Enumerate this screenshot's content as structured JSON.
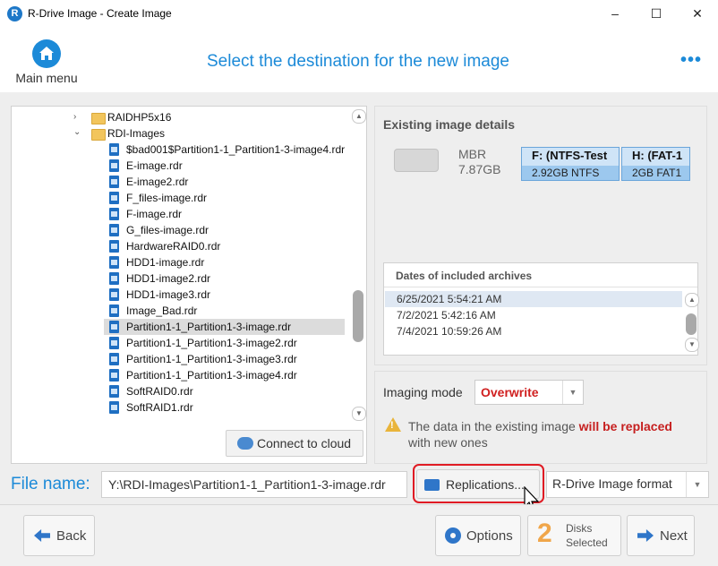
{
  "window": {
    "title": "R-Drive Image - Create Image",
    "logo_letter": "R",
    "minimize": "–",
    "maximize": "☐",
    "close": "✕"
  },
  "header": {
    "main_menu_label": "Main menu",
    "heading": "Select the destination for the new image",
    "more": "•••"
  },
  "tree": {
    "folders": [
      {
        "label": "RAIDHP5x16",
        "chevron": "›"
      },
      {
        "label": "RDI-Images",
        "chevron": "⌄"
      }
    ],
    "files": [
      {
        "label": "$bad001$Partition1-1_Partition1-3-image4.rdr",
        "selected": false
      },
      {
        "label": "E-image.rdr",
        "selected": false
      },
      {
        "label": "E-image2.rdr",
        "selected": false
      },
      {
        "label": "F_files-image.rdr",
        "selected": false
      },
      {
        "label": "F-image.rdr",
        "selected": false
      },
      {
        "label": "G_files-image.rdr",
        "selected": false
      },
      {
        "label": "HardwareRAID0.rdr",
        "selected": false
      },
      {
        "label": "HDD1-image.rdr",
        "selected": false
      },
      {
        "label": "HDD1-image2.rdr",
        "selected": false
      },
      {
        "label": "HDD1-image3.rdr",
        "selected": false
      },
      {
        "label": "Image_Bad.rdr",
        "selected": false
      },
      {
        "label": "Partition1-1_Partition1-3-image.rdr",
        "selected": true
      },
      {
        "label": "Partition1-1_Partition1-3-image2.rdr",
        "selected": false
      },
      {
        "label": "Partition1-1_Partition1-3-image3.rdr",
        "selected": false
      },
      {
        "label": "Partition1-1_Partition1-3-image4.rdr",
        "selected": false
      },
      {
        "label": "SoftRAID0.rdr",
        "selected": false
      },
      {
        "label": "SoftRAID1.rdr",
        "selected": false
      }
    ],
    "connect_cloud_label": "Connect to cloud"
  },
  "details": {
    "title": "Existing image details",
    "disk_type": "MBR",
    "disk_size": "7.87GB",
    "partitions": [
      {
        "name": "F: (NTFS-Test",
        "info": "2.92GB NTFS"
      },
      {
        "name": "H: (FAT-1",
        "info": "2GB FAT1"
      }
    ],
    "dates_header": "Dates of included archives",
    "dates": [
      {
        "label": "6/25/2021 5:54:21 AM",
        "selected": true
      },
      {
        "label": "7/2/2021 5:42:16 AM",
        "selected": false
      },
      {
        "label": "7/4/2021 10:59:26 AM",
        "selected": false
      }
    ]
  },
  "imaging": {
    "mode_label": "Imaging mode",
    "mode_value": "Overwrite",
    "warning_prefix": "The data in the existing image ",
    "warning_strong": "will be replaced",
    "warning_suffix": "with new ones"
  },
  "file": {
    "label": "File name:",
    "value": "Y:\\RDI-Images\\Partition1-1_Partition1-3-image.rdr",
    "replications_label": "Replications...",
    "format_value": "R-Drive Image format"
  },
  "bottom": {
    "back_label": "Back",
    "options_label": "Options",
    "disks_count": "2",
    "disks_line1": "Disks",
    "disks_line2": "Selected",
    "next_label": "Next"
  },
  "colors": {
    "accent": "#1c8ad8",
    "warning_red": "#d02020",
    "highlight": "#e01b24"
  }
}
